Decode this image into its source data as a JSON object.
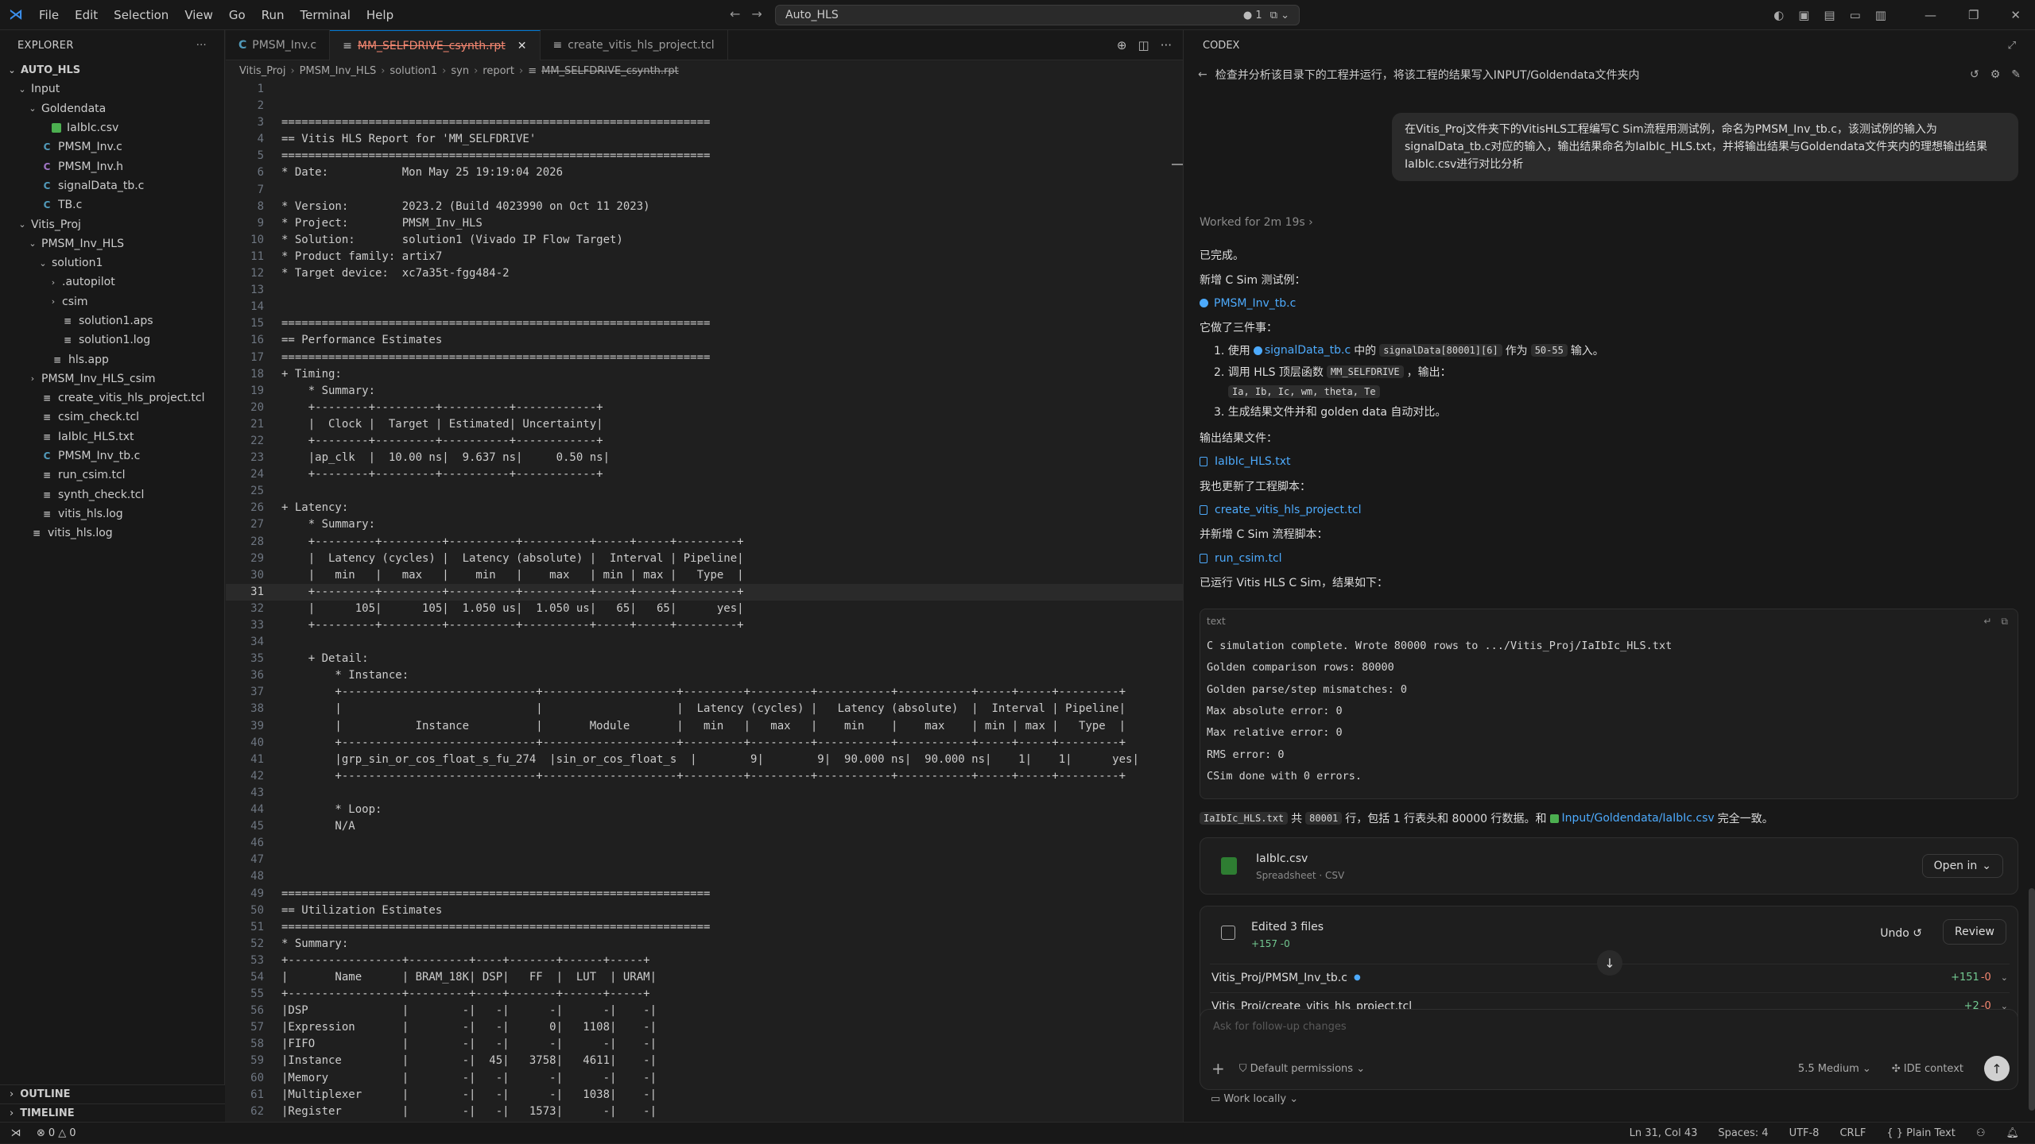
{
  "app": {
    "logo": "VS Code",
    "menu": [
      "File",
      "Edit",
      "Selection",
      "View",
      "Go",
      "Run",
      "Terminal",
      "Help"
    ]
  },
  "command_center": {
    "text": "Auto_HLS",
    "badge": "1"
  },
  "sidebar": {
    "title": "EXPLORER",
    "tree": [
      {
        "label": "AUTO_HLS",
        "depth": 0,
        "chev": "⌄",
        "icon": "",
        "bold": true
      },
      {
        "label": "Input",
        "depth": 1,
        "chev": "⌄",
        "icon": ""
      },
      {
        "label": "Goldendata",
        "depth": 2,
        "chev": "⌄",
        "icon": ""
      },
      {
        "label": "IaIbIc.csv",
        "depth": 3,
        "chev": "",
        "icon": "csv"
      },
      {
        "label": "PMSM_Inv.c",
        "depth": 2,
        "chev": "",
        "icon": "c"
      },
      {
        "label": "PMSM_Inv.h",
        "depth": 2,
        "chev": "",
        "icon": "h"
      },
      {
        "label": "signalData_tb.c",
        "depth": 2,
        "chev": "",
        "icon": "c"
      },
      {
        "label": "TB.c",
        "depth": 2,
        "chev": "",
        "icon": "c"
      },
      {
        "label": "Vitis_Proj",
        "depth": 1,
        "chev": "⌄",
        "icon": ""
      },
      {
        "label": "PMSM_Inv_HLS",
        "depth": 2,
        "chev": "⌄",
        "icon": ""
      },
      {
        "label": "solution1",
        "depth": 3,
        "chev": "⌄",
        "icon": ""
      },
      {
        "label": ".autopilot",
        "depth": 4,
        "chev": "›",
        "icon": ""
      },
      {
        "label": "csim",
        "depth": 4,
        "chev": "›",
        "icon": ""
      },
      {
        "label": "solution1.aps",
        "depth": 4,
        "chev": "",
        "icon": "txt"
      },
      {
        "label": "solution1.log",
        "depth": 4,
        "chev": "",
        "icon": "txt"
      },
      {
        "label": "hls.app",
        "depth": 3,
        "chev": "",
        "icon": "txt"
      },
      {
        "label": "PMSM_Inv_HLS_csim",
        "depth": 2,
        "chev": "›",
        "icon": ""
      },
      {
        "label": "create_vitis_hls_project.tcl",
        "depth": 2,
        "chev": "",
        "icon": "txt"
      },
      {
        "label": "csim_check.tcl",
        "depth": 2,
        "chev": "",
        "icon": "txt"
      },
      {
        "label": "IaIbIc_HLS.txt",
        "depth": 2,
        "chev": "",
        "icon": "txt"
      },
      {
        "label": "PMSM_Inv_tb.c",
        "depth": 2,
        "chev": "",
        "icon": "c"
      },
      {
        "label": "run_csim.tcl",
        "depth": 2,
        "chev": "",
        "icon": "txt"
      },
      {
        "label": "synth_check.tcl",
        "depth": 2,
        "chev": "",
        "icon": "txt"
      },
      {
        "label": "vitis_hls.log",
        "depth": 2,
        "chev": "",
        "icon": "txt"
      },
      {
        "label": "vitis_hls.log",
        "depth": 1,
        "chev": "",
        "icon": "txt"
      }
    ],
    "outline": "OUTLINE",
    "timeline": "TIMELINE"
  },
  "tabs": [
    {
      "label": "PMSM_Inv.c",
      "icon": "C",
      "active": false
    },
    {
      "label": "MM_SELFDRIVE_csynth.rpt",
      "icon": "≡",
      "active": true
    },
    {
      "label": "create_vitis_hls_project.tcl",
      "icon": "≡",
      "active": false
    }
  ],
  "breadcrumb": [
    "Vitis_Proj",
    "PMSM_Inv_HLS",
    "solution1",
    "syn",
    "report",
    "MM_SELFDRIVE_csynth.rpt"
  ],
  "editor": {
    "current_line": 31,
    "lines": [
      "",
      "",
      "================================================================",
      "== Vitis HLS Report for 'MM_SELFDRIVE'",
      "================================================================",
      "* Date:           Mon May 25 19:19:04 2026",
      "",
      "* Version:        2023.2 (Build 4023990 on Oct 11 2023)",
      "* Project:        PMSM_Inv_HLS",
      "* Solution:       solution1 (Vivado IP Flow Target)",
      "* Product family: artix7",
      "* Target device:  xc7a35t-fgg484-2",
      "",
      "",
      "================================================================",
      "== Performance Estimates",
      "================================================================",
      "+ Timing:",
      "    * Summary:",
      "    +--------+---------+----------+------------+",
      "    |  Clock |  Target | Estimated| Uncertainty|",
      "    +--------+---------+----------+------------+",
      "    |ap_clk  |  10.00 ns|  9.637 ns|     0.50 ns|",
      "    +--------+---------+----------+------------+",
      "",
      "+ Latency:",
      "    * Summary:",
      "    +---------+---------+----------+----------+-----+-----+---------+",
      "    |  Latency (cycles) |  Latency (absolute) |  Interval | Pipeline|",
      "    |   min   |   max   |    min   |    max   | min | max |   Type  |",
      "    +---------+---------+----------+----------+-----+-----+---------+",
      "    |      105|      105|  1.050 us|  1.050 us|   65|   65|      yes|",
      "    +---------+---------+----------+----------+-----+-----+---------+",
      "",
      "    + Detail:",
      "        * Instance:",
      "        +-----------------------------+--------------------+---------+---------+-----------+-----------+-----+-----+---------+",
      "        |                             |                    |  Latency (cycles) |   Latency (absolute)  |  Interval | Pipeline|",
      "        |           Instance          |       Module       |   min   |   max   |    min    |    max    | min | max |   Type  |",
      "        +-----------------------------+--------------------+---------+---------+-----------+-----------+-----+-----+---------+",
      "        |grp_sin_or_cos_float_s_fu_274  |sin_or_cos_float_s  |        9|        9|  90.000 ns|  90.000 ns|    1|    1|      yes|",
      "        +-----------------------------+--------------------+---------+---------+-----------+-----------+-----+-----+---------+",
      "",
      "        * Loop:",
      "        N/A",
      "",
      "",
      "",
      "================================================================",
      "== Utilization Estimates",
      "================================================================",
      "* Summary:",
      "+-----------------+---------+----+-------+------+-----+",
      "|       Name      | BRAM_18K| DSP|   FF  |  LUT  | URAM|",
      "+-----------------+---------+----+-------+------+-----+",
      "|DSP              |        -|   -|      -|      -|    -|",
      "|Expression       |        -|   -|      0|   1108|    -|",
      "|FIFO             |        -|   -|      -|      -|    -|",
      "|Instance         |        -|  45|   3758|   4611|    -|",
      "|Memory           |        -|   -|      -|      -|    -|",
      "|Multiplexer      |        -|   -|      -|   1038|    -|",
      "|Register         |        -|   -|   1573|      -|    -|",
      "+-----------------+---------+----+-------+------+-----+"
    ]
  },
  "codex": {
    "title": "CODEX",
    "thread_title": "检查并分析该目录下的工程并运行，将该工程的结果写入INPUT/Goldendata文件夹内",
    "user_message": "在Vitis_Proj文件夹下的VitisHLS工程编写C Sim流程用测试例，命名为PMSM_Inv_tb.c，该测试例的输入为signalData_tb.c对应的输入，输出结果命名为IaIbIc_HLS.txt，并将输出结果与Goldendata文件夹内的理想输出结果IaIbIc.csv进行对比分析",
    "worked": "Worked for 2m 19s",
    "done": "已完成。",
    "added_test": "新增 C Sim 测试例：",
    "tb_file": "PMSM_Inv_tb.c",
    "did_three": "它做了三件事：",
    "step1_a": "1. 使用",
    "step1_link": "signalData_tb.c",
    "step1_b": "中的",
    "step1_code1": "signalData[80001][6]",
    "step1_c": "作为",
    "step1_code2": "50-55",
    "step1_d": "输入。",
    "step2_a": "2. 调用 HLS 顶层函数",
    "step2_code": "MM_SELFDRIVE",
    "step2_b": "，输出：",
    "step2_outputs": "Ia, Ib, Ic, wm, theta, Te",
    "step3": "3. 生成结果文件并和 golden data 自动对比。",
    "output_file_label": "输出结果文件：",
    "output_file": "IaIbIc_HLS.txt",
    "updated_script_label": "我也更新了工程脚本：",
    "updated_script": "create_vitis_hls_project.tcl",
    "added_flow_label": "并新增 C Sim 流程脚本：",
    "flow_script": "run_csim.tcl",
    "ran_label": "已运行 Vitis HLS C Sim，结果如下：",
    "code_lang": "text",
    "code_lines": [
      "C simulation complete. Wrote 80000 rows to .../Vitis_Proj/IaIbIc_HLS.txt",
      "Golden comparison rows: 80000",
      "Golden parse/step mismatches: 0",
      "Max absolute error: 0",
      "Max relative error: 0",
      "RMS error: 0",
      "CSim done with 0 errors."
    ],
    "sum_code": "IaIbIc_HLS.txt",
    "sum_a": "共",
    "sum_code2": "80001",
    "sum_b": "行，包括 1 行表头和 80000 行数据。和",
    "sum_link": "Input/Goldendata/IaIbIc.csv",
    "sum_c": "完全一致。",
    "card_name": "IaIbIc.csv",
    "card_sub": "Spreadsheet · CSV",
    "card_open": "Open in",
    "edits_title": "Edited 3 files",
    "edits_stat": "+157 -0",
    "undo": "Undo",
    "review": "Review",
    "edit_rows": [
      {
        "file": "Vitis_Proj/PMSM_Inv_tb.c",
        "plus": "+151",
        "minus": "-0"
      },
      {
        "file": "Vitis_Proj/create_vitis_hls_project.tcl",
        "plus": "+2",
        "minus": "-0"
      }
    ],
    "placeholder": "Ask for follow-up changes",
    "permissions": "Default permissions",
    "model": "5.5",
    "effort": "Medium",
    "ide_context": "IDE context",
    "work_locally": "Work locally"
  },
  "status": {
    "errors": "0",
    "warnings": "0",
    "position": "Ln 31, Col 43",
    "spaces": "Spaces: 4",
    "encoding": "UTF-8",
    "eol": "CRLF",
    "language": "Plain Text"
  }
}
